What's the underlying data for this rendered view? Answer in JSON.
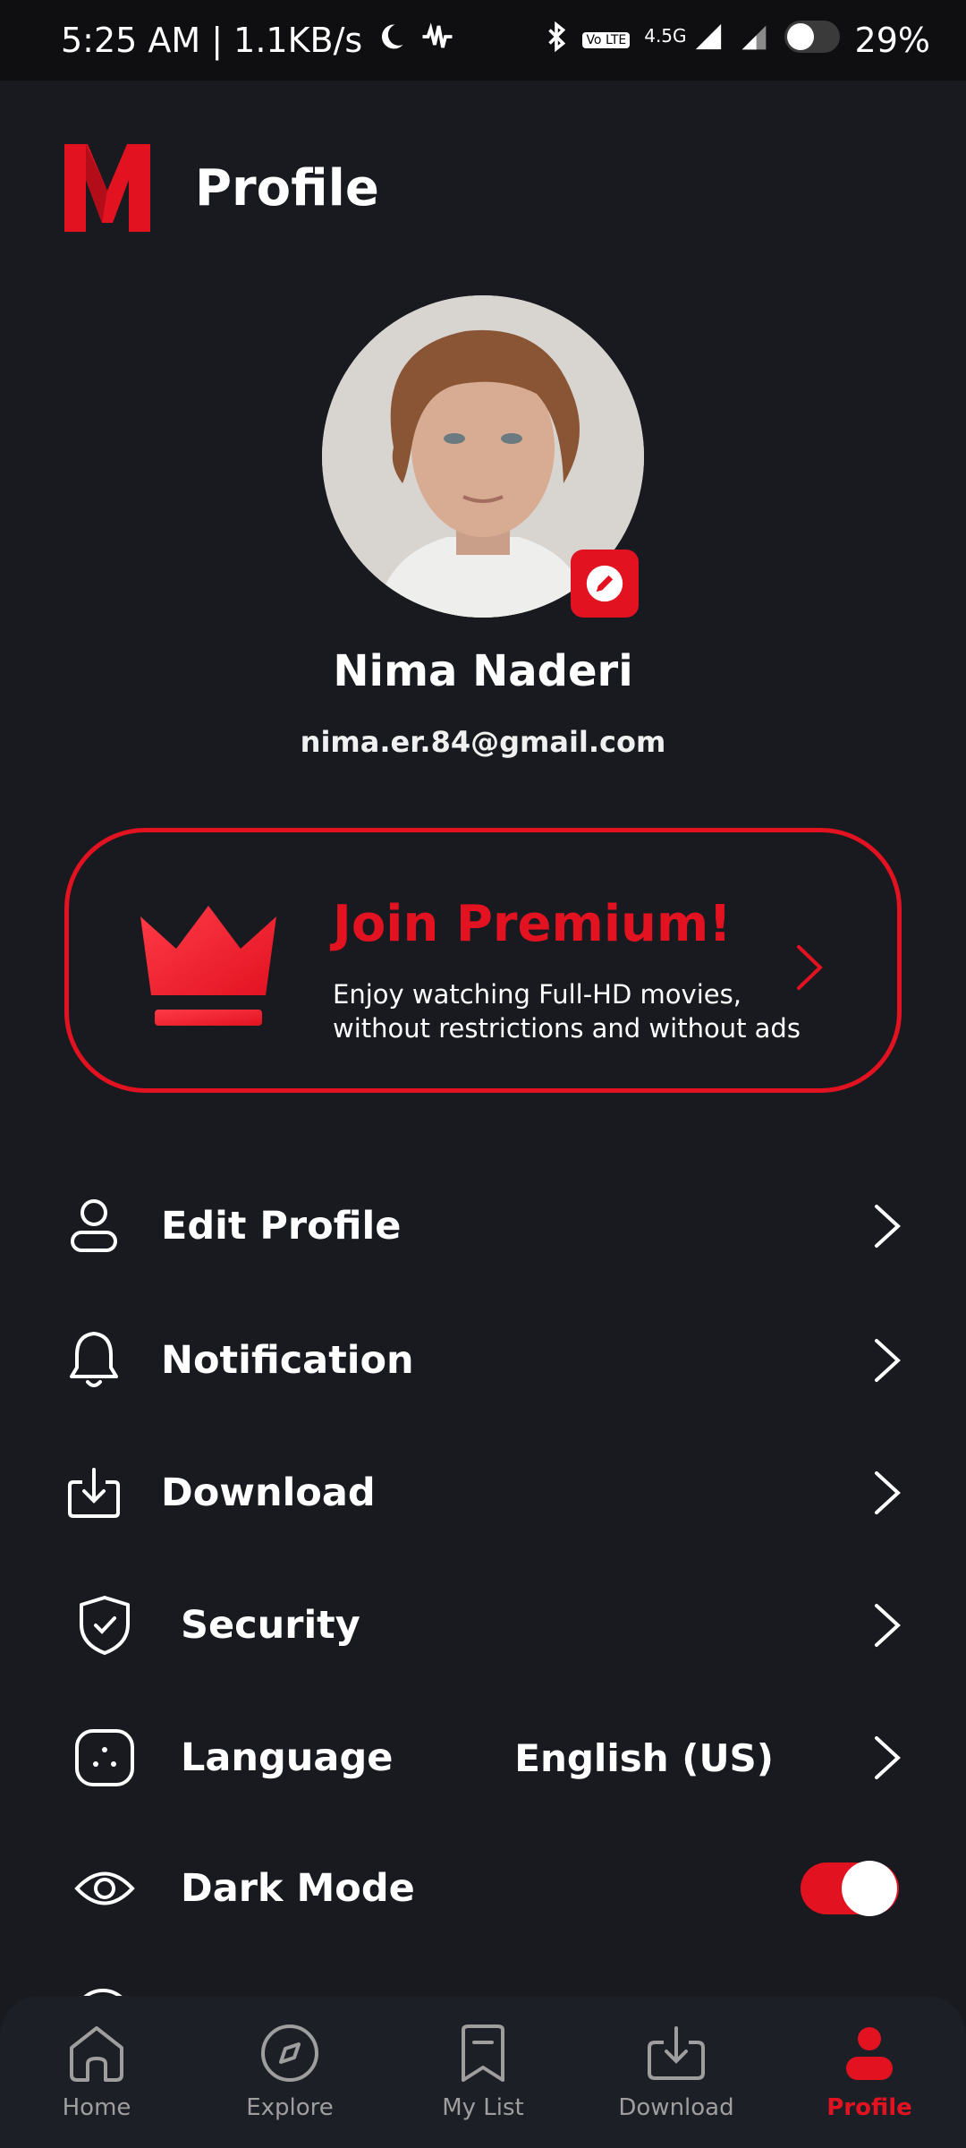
{
  "status_bar": {
    "time_speed": "5:25 AM | 1.1KB/s",
    "network": "4.5G",
    "volte": "Vo LTE",
    "battery": "29%"
  },
  "header": {
    "title": "Profile"
  },
  "profile": {
    "name": "Nima Naderi",
    "email": "nima.er.84@gmail.com"
  },
  "premium": {
    "title": "Join Premium!",
    "description_line1": "Enjoy watching Full-HD movies,",
    "description_line2": "without restrictions and without ads"
  },
  "menu": {
    "edit_profile": "Edit Profile",
    "notification": "Notification",
    "download": "Download",
    "security": "Security",
    "language": "Language",
    "language_value": "English (US)",
    "dark_mode": "Dark Mode",
    "dark_mode_on": true
  },
  "nav": {
    "home": "Home",
    "explore": "Explore",
    "my_list": "My List",
    "download": "Download",
    "profile": "Profile",
    "active": "profile"
  },
  "colors": {
    "accent": "#e21221",
    "background": "#181a20",
    "nav_background": "#1d1f26",
    "inactive": "#9e9e9e"
  }
}
